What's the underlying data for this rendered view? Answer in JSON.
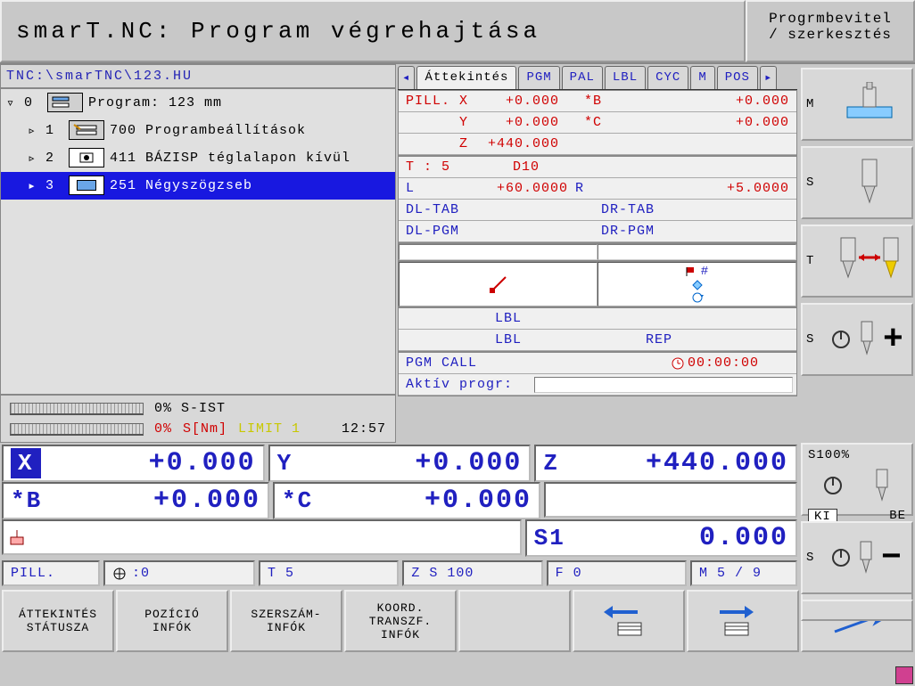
{
  "title": {
    "main": "smarT.NC: Program végrehajtása",
    "side1": "Progrmbevitel",
    "side2": "/ szerkesztés"
  },
  "path": "TNC:\\smarTNC\\123.HU",
  "tree": {
    "r0": {
      "arrow": "▿",
      "num": "0",
      "label": "Program: 123 mm"
    },
    "r1": {
      "arrow": "▹",
      "num": "1",
      "label": "700 Programbeállítások"
    },
    "r2": {
      "arrow": "▹",
      "num": "2",
      "label": "411 BÁZISP téglalapon kívül"
    },
    "r3": {
      "arrow": "▸",
      "num": "3",
      "label": "251 Négyszögzseb"
    }
  },
  "status": {
    "sist": "0% S-IST",
    "snm_pct": "0%",
    "snm_lbl": "S[Nm]",
    "limit": "LIMIT 1",
    "time": "12:57"
  },
  "tabs": {
    "t0": "Áttekintés",
    "t1": "PGM",
    "t2": "PAL",
    "t3": "LBL",
    "t4": "CYC",
    "t5": "M",
    "t6": "POS"
  },
  "pill": {
    "label": "PILL.",
    "x": "X",
    "xv": "+0.000",
    "sb": "*B",
    "sbv": "+0.000",
    "y": "Y",
    "yv": "+0.000",
    "sc": "*C",
    "scv": "+0.000",
    "z": "Z",
    "zv": "+440.000"
  },
  "tool": {
    "t": "T : 5",
    "d": "D10",
    "l": "L",
    "lv": "+60.0000",
    "r": "R",
    "rv": "+5.0000",
    "dltab": "DL-TAB",
    "drtab": "DR-TAB",
    "dlpgm": "DL-PGM",
    "drpgm": "DR-PGM"
  },
  "lbl": {
    "l1": "LBL",
    "l2": "LBL",
    "rep": "REP"
  },
  "pgm": {
    "call": "PGM CALL",
    "timer": "00:00:00",
    "active": "Aktív progr:"
  },
  "dro": {
    "x": "X",
    "xv": "+0.000",
    "y": "Y",
    "yv": "+0.000",
    "z": "Z",
    "zv": "+440.000",
    "b": "*B",
    "bv": "+0.000",
    "c": "*C",
    "cv": "+0.000",
    "s": "S1",
    "sv": "0.000"
  },
  "bstat": {
    "pill": "PILL.",
    "ref": ":0",
    "t": "T 5",
    "zs": "Z S 100",
    "f": "F 0",
    "m": "M 5 / 9"
  },
  "soft": {
    "k0a": "ÁTTEKINTÉS",
    "k0b": "STÁTUSZA",
    "k1a": "POZÍCIÓ",
    "k1b": "INFÓK",
    "k2a": "SZERSZÁM-",
    "k2b": "INFÓK",
    "k3a": "KOORD.",
    "k3b": "TRANSZF.",
    "k3c": "INFÓK"
  },
  "side": {
    "m": "M",
    "s": "S",
    "t": "T",
    "s2": "S",
    "s100": "S100%",
    "ki": "KI",
    "be": "BE",
    "s3": "S"
  }
}
